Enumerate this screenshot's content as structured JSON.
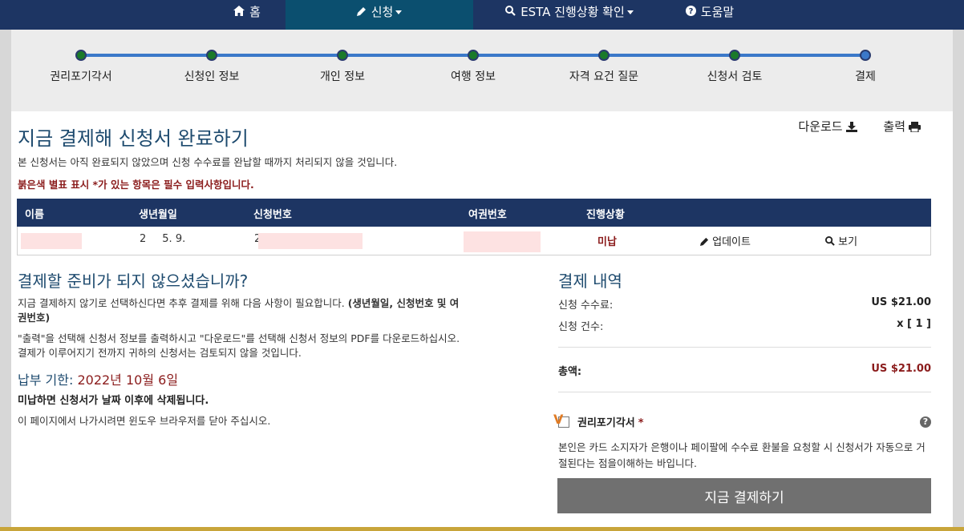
{
  "nav": {
    "home": "홈",
    "apply": "신청",
    "status": "ESTA 진행상황 확인",
    "help": "도움말"
  },
  "steps": [
    "권리포기각서",
    "신청인 정보",
    "개인 정보",
    "여행 정보",
    "자격 요건 질문",
    "신청서 검토",
    "결제"
  ],
  "page": {
    "title": "지금 결제해 신청서 완료하기",
    "download": "다운로드",
    "print": "출력",
    "notice": "본 신청서는 아직 완료되지 않았으며 신청 수수료를 완납할 때까지 처리되지 않을 것입니다.",
    "required": "붉은색 별표 표시 *가 있는 항목은 필수 입력사항입니다."
  },
  "table": {
    "headers": {
      "name": "이름",
      "dob": "생년월일",
      "appno": "신청번호",
      "passport": "여권번호",
      "status": "진행상황"
    },
    "row": {
      "dob_a": "2",
      "dob_b": "5. 9.",
      "appno": "2",
      "status": "미납",
      "update": "업데이트",
      "view": "보기"
    }
  },
  "left": {
    "heading": "결제할 준비가 되지 않으셨습니까?",
    "para1_a": "지금 결제하지 않기로 선택하신다면 추후 결제를 위해 다음 사항이 필요합니다. ",
    "para1_b": "(생년월일, 신청번호 및 여권번호)",
    "para2": "\"출력\"을 선택해 신청서 정보를 출력하시고 \"다운로드\"를 선택해 신청서 정보의 PDF를 다운로드하십시오. 결제가 이루어지기 전까지 귀하의 신청서는 검토되지 않을 것입니다.",
    "due_label": "납부 기한: ",
    "due_date": "2022년 10월 6일",
    "delete_note": "미납하면 신청서가 날짜 이후에 삭제됩니다.",
    "close_note": "이 페이지에서 나가시려면 윈도우 브라우저를 닫아 주십시오."
  },
  "payment": {
    "heading": "결제 내역",
    "fee_label": "신청 수수료:",
    "fee_value": "US $21.00",
    "count_label": "신청 건수:",
    "count_value": "x [ 1 ]",
    "total_label": "총액:",
    "total_value": "US $21.00",
    "waiver_label": "권리포기각서",
    "waiver_star": "*",
    "waiver_text": "본인은 카드 소지자가 은행이나 페이팔에 수수료 환불을 요청할 시 신청서가 자동으로 거절된다는 점을이해하는 바입니다.",
    "pay_button": "지금 결제하기"
  },
  "colors": {
    "navy": "#1d3563",
    "unpaid_red": "#8b1c1c",
    "progress_blue": "#3b78c9",
    "step_green": "#1a7a2a"
  }
}
